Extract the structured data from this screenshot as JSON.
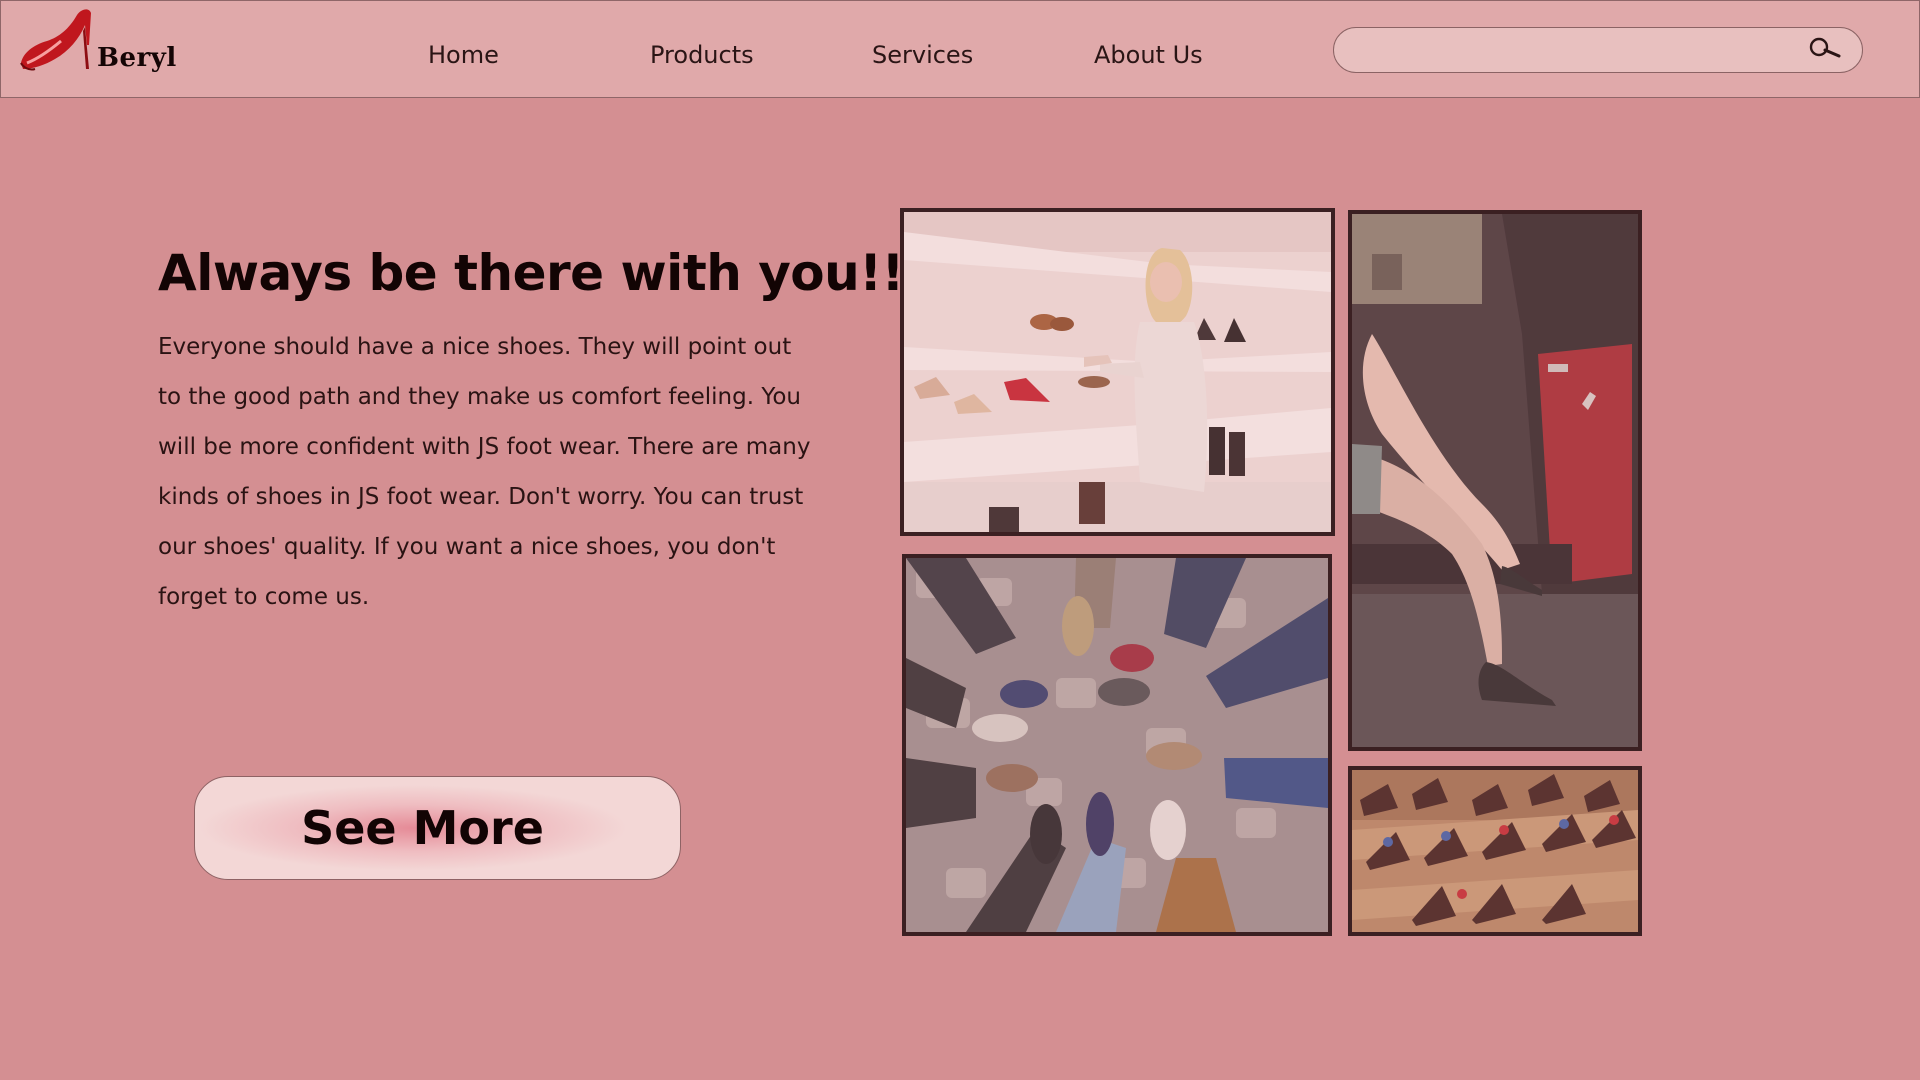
{
  "brand": {
    "name": "Beryl",
    "logo_icon": "red-high-heel-icon"
  },
  "nav": {
    "items": [
      {
        "label": "Home"
      },
      {
        "label": "Products"
      },
      {
        "label": "Services"
      },
      {
        "label": "About Us"
      }
    ]
  },
  "search": {
    "placeholder": "",
    "value": "",
    "icon": "search-icon"
  },
  "hero": {
    "title": "Always be there with you!!!",
    "body": "Everyone should have a nice shoes. They will point out to the good path and they make us comfort feeling. You will be more confident with JS foot wear. There are many kinds of shoes in JS foot wear. Don't worry. You can trust our shoes' quality. If you want a nice shoes, you don't forget to come us.",
    "cta_label": "See More"
  },
  "gallery": {
    "images": [
      {
        "depicts": "woman-shopping-shoes-photo"
      },
      {
        "depicts": "legs-high-heels-car-photo"
      },
      {
        "depicts": "circle-of-sneakers-photo"
      },
      {
        "depicts": "leather-shoes-display-photo"
      }
    ]
  },
  "colors": {
    "background": "#d48f92",
    "header": "#e0a9aa",
    "accent_red": "#c0171e",
    "frame": "#3b2022"
  }
}
